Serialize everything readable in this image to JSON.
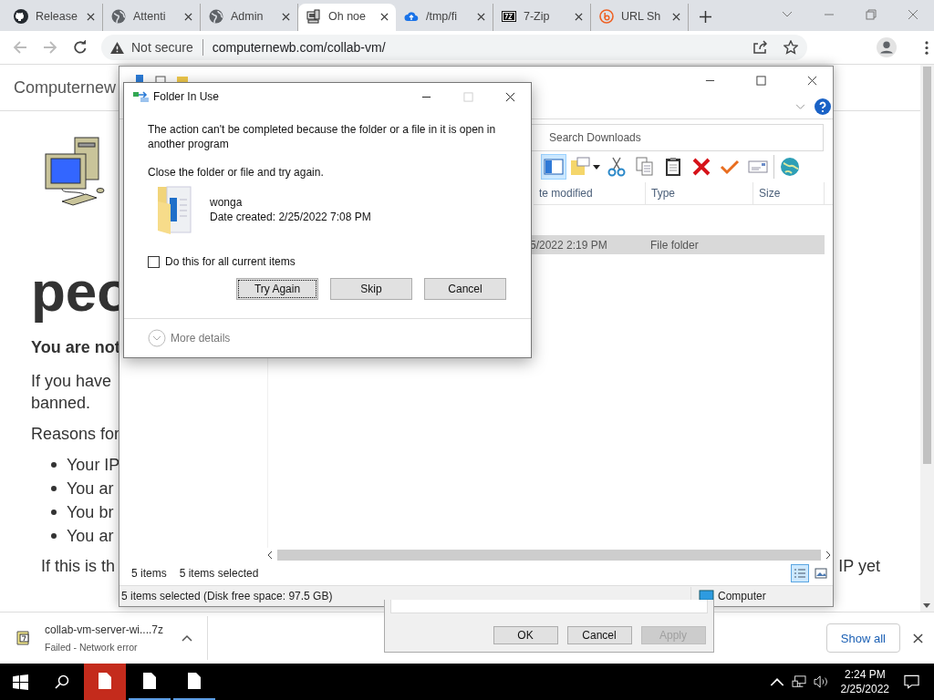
{
  "browser": {
    "tabs": [
      {
        "title": "Release",
        "kind": "github",
        "selected": false
      },
      {
        "title": "Attenti",
        "kind": "globe",
        "selected": false
      },
      {
        "title": "Admin",
        "kind": "globe",
        "selected": false
      },
      {
        "title": "Oh noe",
        "kind": "computer",
        "selected": true
      },
      {
        "title": "/tmp/fi",
        "kind": "cloud",
        "selected": false
      },
      {
        "title": "7-Zip",
        "kind": "archive",
        "selected": false
      },
      {
        "title": "URL Sh",
        "kind": "bitly",
        "selected": false
      }
    ],
    "address": {
      "security": "Not secure",
      "url": "computernewb.com/collab-vm/"
    }
  },
  "page": {
    "site_title": "Computernew",
    "heading": "peo",
    "notice": "You are not",
    "paragraph_lines": [
      "If you have",
      "banned."
    ],
    "reasons_intro": "Reasons for",
    "reasons": [
      "Your IP",
      "You ar",
      "You br",
      "You ar"
    ],
    "footer_line": "If this is th",
    "right_fragment": "IP yet"
  },
  "explorer": {
    "search": {
      "placeholder": "Search Downloads"
    },
    "toolbar": [
      {
        "kind": "pane",
        "selected": true
      },
      {
        "kind": "folder",
        "selected": false
      },
      {
        "kind": "cut",
        "selected": false
      },
      {
        "kind": "copy",
        "selected": false
      },
      {
        "kind": "paste",
        "selected": false
      },
      {
        "kind": "delete",
        "selected": false
      },
      {
        "kind": "check",
        "selected": false
      },
      {
        "kind": "card",
        "selected": false
      },
      {
        "kind": "globe",
        "selected": false
      }
    ],
    "columns": [
      "te modified",
      "Type",
      "Size"
    ],
    "rows": [
      {
        "cells": [
          "5/2022 2:19 PM",
          "File folder"
        ],
        "selected": true
      }
    ],
    "item_count": "5 items",
    "selected_count": "5 items selected",
    "views": [
      {
        "kind": "details",
        "selected": true
      },
      {
        "kind": "thumbnails",
        "selected": false
      }
    ],
    "status": "5 items selected (Disk free space: 97.5 GB)",
    "location": "Computer"
  },
  "dialog": {
    "title": "Folder In Use",
    "maximize_disabled": true,
    "message": "The action can't be completed because the folder or a file in it is open in another program",
    "instruction": "Close the folder or file and try again.",
    "item": {
      "name": "wonga",
      "created": "Date created: 2/25/2022 7:08 PM"
    },
    "checkbox": {
      "label": "Do this for all current items",
      "checked": false
    },
    "buttons": [
      {
        "label": "Try Again",
        "focused": true
      },
      {
        "label": "Skip",
        "focused": false
      },
      {
        "label": "Cancel",
        "focused": false
      }
    ],
    "details": "More details"
  },
  "back_dialog": {
    "buttons": [
      {
        "label": "OK",
        "disabled": false
      },
      {
        "label": "Cancel",
        "disabled": false
      },
      {
        "label": "Apply",
        "disabled": true
      }
    ]
  },
  "downloads": {
    "file": "collab-vm-server-wi....7z",
    "status": "Failed - Network error",
    "show_all": "Show all"
  },
  "taskbar": {
    "apps": [
      {
        "active": true
      },
      {
        "active": false
      },
      {
        "active": false
      }
    ],
    "time": "2:24 PM",
    "date": "2/25/2022"
  }
}
